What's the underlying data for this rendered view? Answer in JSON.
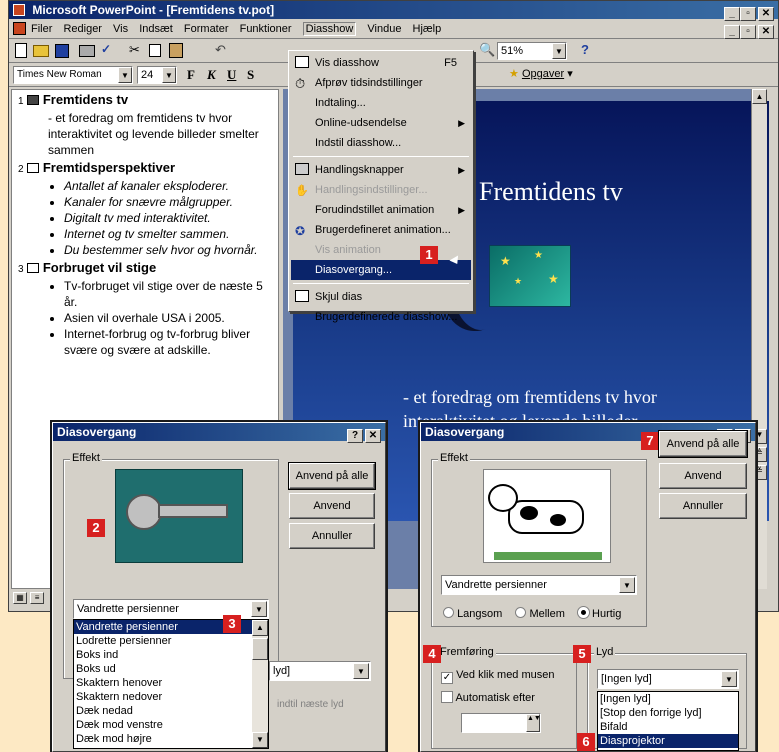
{
  "window": {
    "title": "Microsoft PowerPoint - [Fremtidens tv.pot]"
  },
  "menubar": [
    "Filer",
    "Rediger",
    "Vis",
    "Indsæt",
    "Formater",
    "Funktioner",
    "Diasshow",
    "Vindue",
    "Hjælp"
  ],
  "toolbar": {
    "font": "Times New Roman",
    "size": "24",
    "zoom": "51%",
    "opgaver": "Opgaver"
  },
  "diasshow_menu": {
    "items": [
      {
        "label": "Vis diasshow",
        "shortcut": "F5"
      },
      {
        "label": "Afprøv tidsindstillinger"
      },
      {
        "label": "Indtaling..."
      },
      {
        "label": "Online-udsendelse"
      },
      {
        "label": "Indstil diasshow..."
      },
      {
        "label": "Handlingsknapper"
      },
      {
        "label": "Handlingsindstillinger..."
      },
      {
        "label": "Forudindstillet animation"
      },
      {
        "label": "Brugerdefineret animation..."
      },
      {
        "label": "Vis animation"
      },
      {
        "label": "Diasovergang..."
      },
      {
        "label": "Skjul dias"
      },
      {
        "label": "Brugerdefinerede diasshow..."
      }
    ]
  },
  "outline": {
    "s1_num": "1",
    "s1_title": "Fremtidens tv",
    "s1_body": "- et foredrag om fremtidens tv hvor interaktivitet og levende billeder smelter sammen",
    "s2_num": "2",
    "s2_title": "Fremtidsperspektiver",
    "s2_bullets": [
      "Antallet af kanaler eksploderer.",
      "Kanaler for snævre målgrupper.",
      "Digitalt tv med interaktivitet.",
      "Internet og tv smelter sammen.",
      "Du bestemmer selv hvor og hvornår."
    ],
    "s3_num": "3",
    "s3_title": "Forbruget vil stige",
    "s3_bullets": [
      "Tv-forbruget vil stige over de næste 5 år.",
      "Asien vil overhale USA i 2005.",
      "Internet-forbrug og tv-forbrug bliver svære og svære at adskille."
    ]
  },
  "slide": {
    "title": "Fremtidens tv",
    "subtitle": "- et foredrag om fremtidens tv hvor interaktivitet og levende billeder"
  },
  "dialog_left": {
    "title": "Diasovergang",
    "effekt": "Effekt",
    "btn_all": "Anvend på alle",
    "btn_apply": "Anvend",
    "btn_cancel": "Annuller",
    "combo": "Vandrette persienner",
    "list": [
      "Vandrette persienner",
      "Lodrette persienner",
      "Boks ind",
      "Boks ud",
      "Skaktern henover",
      "Skaktern nedover",
      "Dæk nedad",
      "Dæk mod venstre",
      "Dæk mod højre"
    ],
    "lyd_value": "lyd]",
    "hint": "indtil næste lyd"
  },
  "dialog_right": {
    "title": "Diasovergang",
    "effekt": "Effekt",
    "btn_all": "Anvend på alle",
    "btn_apply": "Anvend",
    "btn_cancel": "Annuller",
    "combo": "Vandrette persienner",
    "speed": [
      "Langsom",
      "Mellem",
      "Hurtig"
    ],
    "fremforing": "Fremføring",
    "cb1": "Ved klik med musen",
    "cb2": "Automatisk efter",
    "lyd": "Lyd",
    "lyd_value": "[Ingen lyd]",
    "lyd_list": [
      "[Ingen lyd]",
      "[Stop den forrige lyd]",
      "Bifald",
      "Diasprojektor"
    ]
  },
  "badges": [
    "1",
    "2",
    "3",
    "4",
    "5",
    "6",
    "7"
  ],
  "colors": {
    "titlebar": "#0a246a",
    "badge": "#d7201f",
    "slide_bg": "#1b3f8e",
    "background": "#fde9c4"
  }
}
